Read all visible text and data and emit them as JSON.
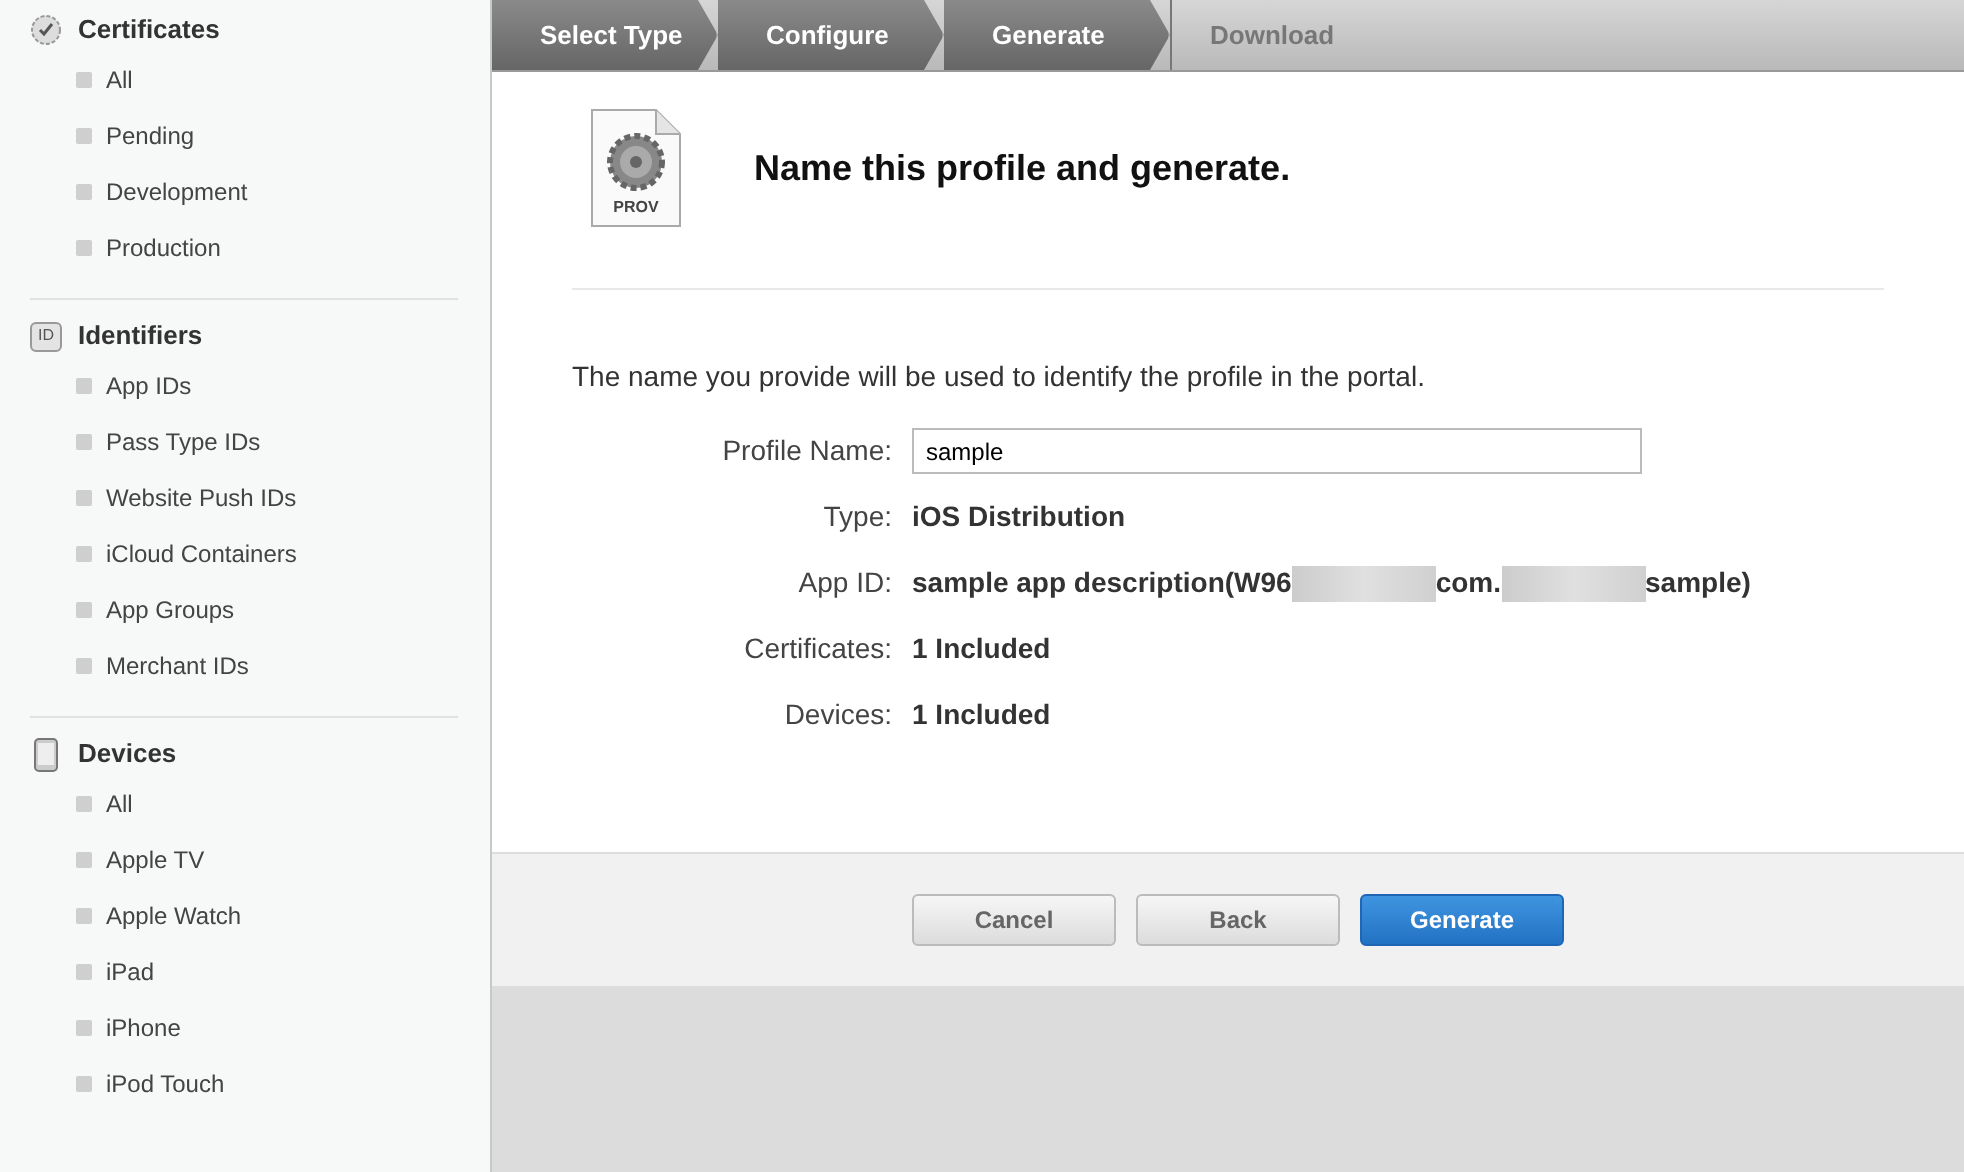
{
  "sidebar": {
    "sections": [
      {
        "kind": "certificates",
        "title": "Certificates",
        "items": [
          "All",
          "Pending",
          "Development",
          "Production"
        ]
      },
      {
        "kind": "identifiers",
        "icon_text": "ID",
        "title": "Identifiers",
        "items": [
          "App IDs",
          "Pass Type IDs",
          "Website Push IDs",
          "iCloud Containers",
          "App Groups",
          "Merchant IDs"
        ]
      },
      {
        "kind": "devices",
        "title": "Devices",
        "items": [
          "All",
          "Apple TV",
          "Apple Watch",
          "iPad",
          "iPhone",
          "iPod Touch"
        ]
      }
    ]
  },
  "steps": [
    {
      "label": "Select Type",
      "completed": true
    },
    {
      "label": "Configure",
      "completed": true
    },
    {
      "label": "Generate",
      "completed": true
    },
    {
      "label": "Download",
      "completed": false
    }
  ],
  "header": {
    "icon_label": "PROV",
    "title": "Name this profile and generate."
  },
  "intro": "The name you provide will be used to identify the profile in the portal.",
  "fields": [
    {
      "kind": "input",
      "label": "Profile Name:",
      "value": "sample"
    },
    {
      "kind": "text",
      "label": "Type:",
      "segments": [
        {
          "kind": "text",
          "text": "iOS Distribution"
        }
      ]
    },
    {
      "kind": "text",
      "label": "App ID:",
      "segments": [
        {
          "kind": "text",
          "text": "sample app description(W96"
        },
        {
          "kind": "redacted"
        },
        {
          "kind": "text",
          "text": "com."
        },
        {
          "kind": "redacted"
        },
        {
          "kind": "text",
          "text": "sample)"
        }
      ]
    },
    {
      "kind": "text",
      "label": "Certificates:",
      "segments": [
        {
          "kind": "text",
          "text": "1 Included"
        }
      ]
    },
    {
      "kind": "text",
      "label": "Devices:",
      "segments": [
        {
          "kind": "text",
          "text": "1 Included"
        }
      ]
    }
  ],
  "buttons": [
    {
      "label": "Cancel",
      "primary": false
    },
    {
      "label": "Back",
      "primary": false
    },
    {
      "label": "Generate",
      "primary": true
    }
  ]
}
